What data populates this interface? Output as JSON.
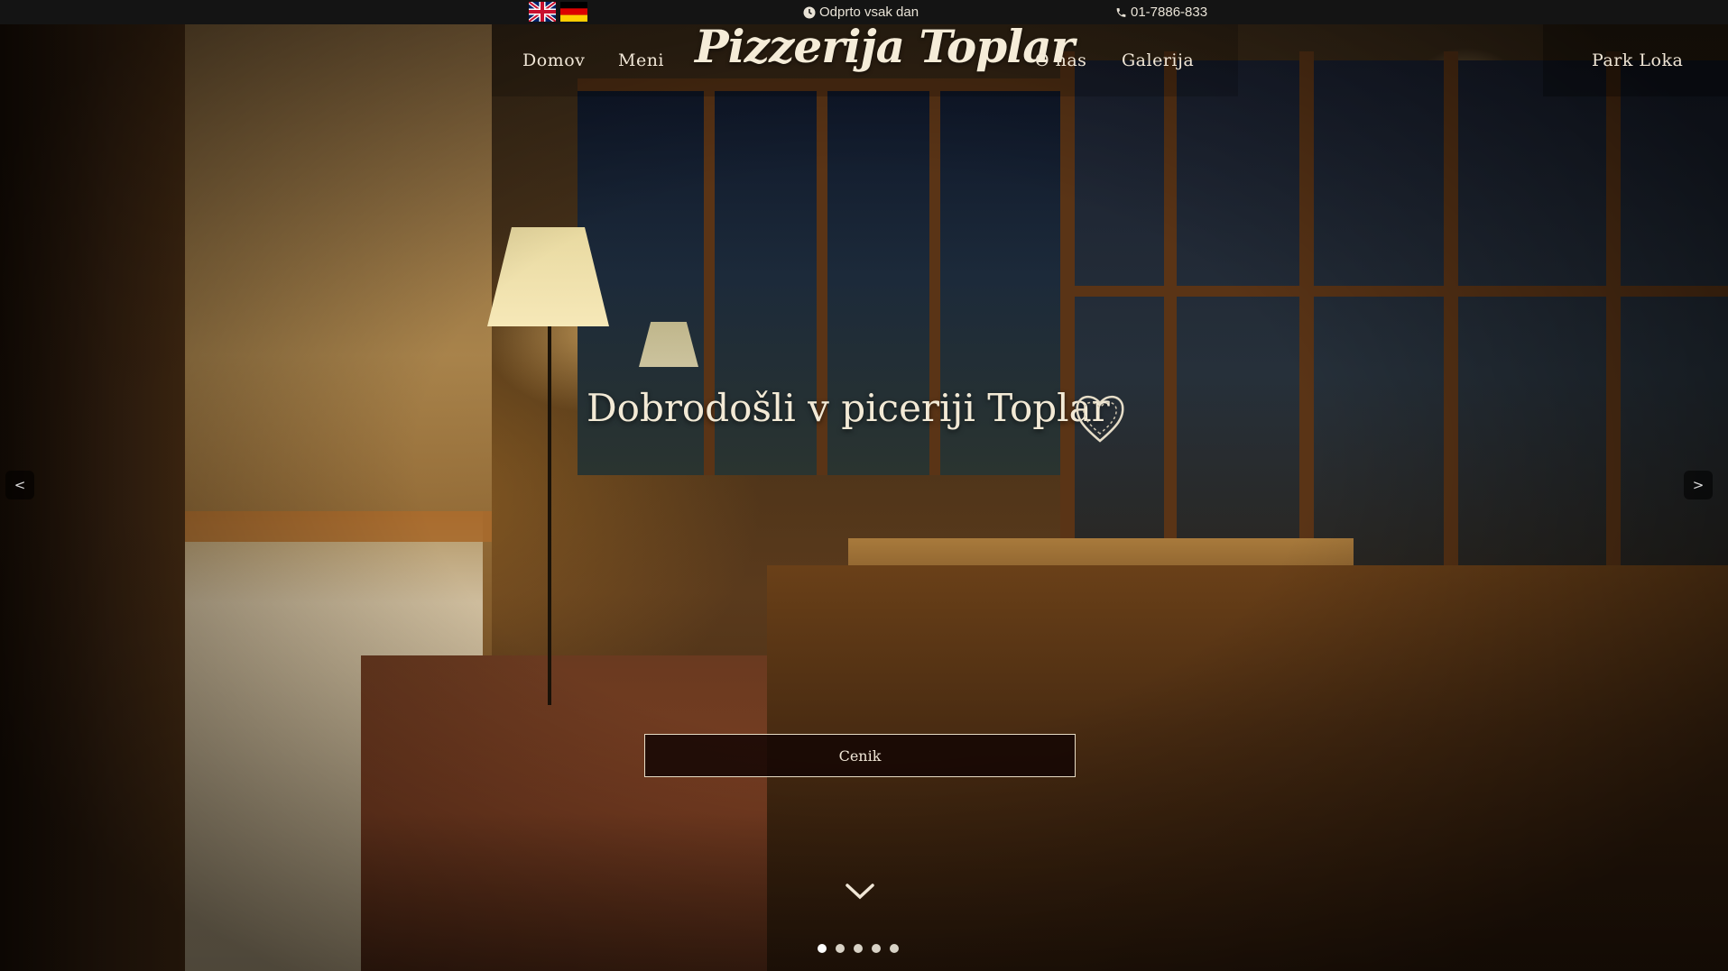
{
  "topbar": {
    "languages": [
      {
        "icon": "uk-flag-icon"
      },
      {
        "icon": "de-flag-icon"
      }
    ],
    "hours": "Odprto vsak dan",
    "phone": "01-7886-833"
  },
  "nav": {
    "home": "Domov",
    "menu": "Meni",
    "logo": "Pizzerija Toplar",
    "about": "O nas",
    "gallery": "Galerija",
    "park": "Park Loka"
  },
  "hero": {
    "title": "Dobrodošli v piceriji Toplar",
    "cta": "Cenik",
    "prev": "<",
    "next": ">",
    "slides": 5,
    "active_slide": 1
  },
  "colors": {
    "topbar": "#141414",
    "text": "#f0e6d6",
    "button_bg": "#14060a",
    "button_border": "#e8dcc4"
  }
}
